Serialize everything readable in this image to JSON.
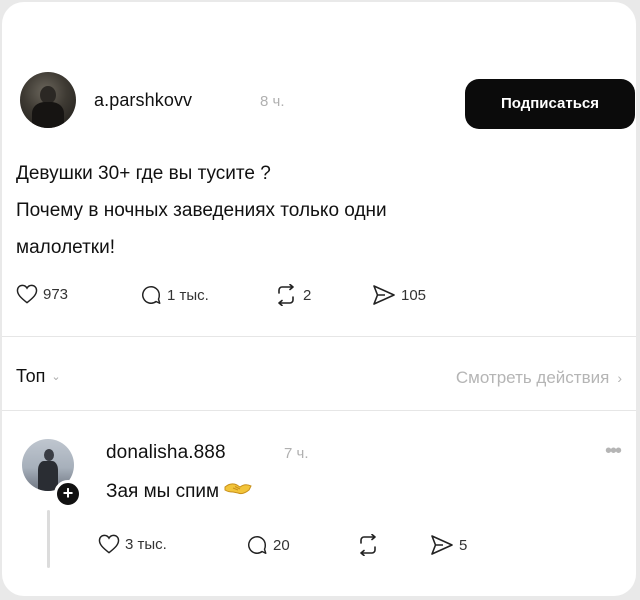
{
  "post": {
    "username": "a.parshkovv",
    "time": "8 ч.",
    "subscribe_label": "Подписаться",
    "text_lines": [
      "Девушки 30+ где вы тусите ?",
      "Почему в ночных заведениях только  одни",
      "малолетки!"
    ],
    "actions": {
      "likes": "973",
      "comments": "1 тыс.",
      "reposts": "2",
      "shares": "105"
    }
  },
  "filter": {
    "sort_label": "Топ",
    "view_actions_label": "Смотреть действия"
  },
  "comment": {
    "username": "donalisha.888",
    "time": "7 ч.",
    "text": "Зая мы спим",
    "actions": {
      "likes": "3 тыс.",
      "comments": "20",
      "reposts": "",
      "shares": "5"
    }
  },
  "icons": {
    "avatar": "profile-photo",
    "like": "heart-outline-icon",
    "comment": "speech-bubble-icon",
    "repost": "repost-arrows-icon",
    "share": "paper-plane-icon",
    "more": "ellipsis-icon",
    "follow": "plus-icon"
  },
  "colors": {
    "button_bg": "#0b0b0b",
    "muted_text": "#b0b0b0"
  }
}
